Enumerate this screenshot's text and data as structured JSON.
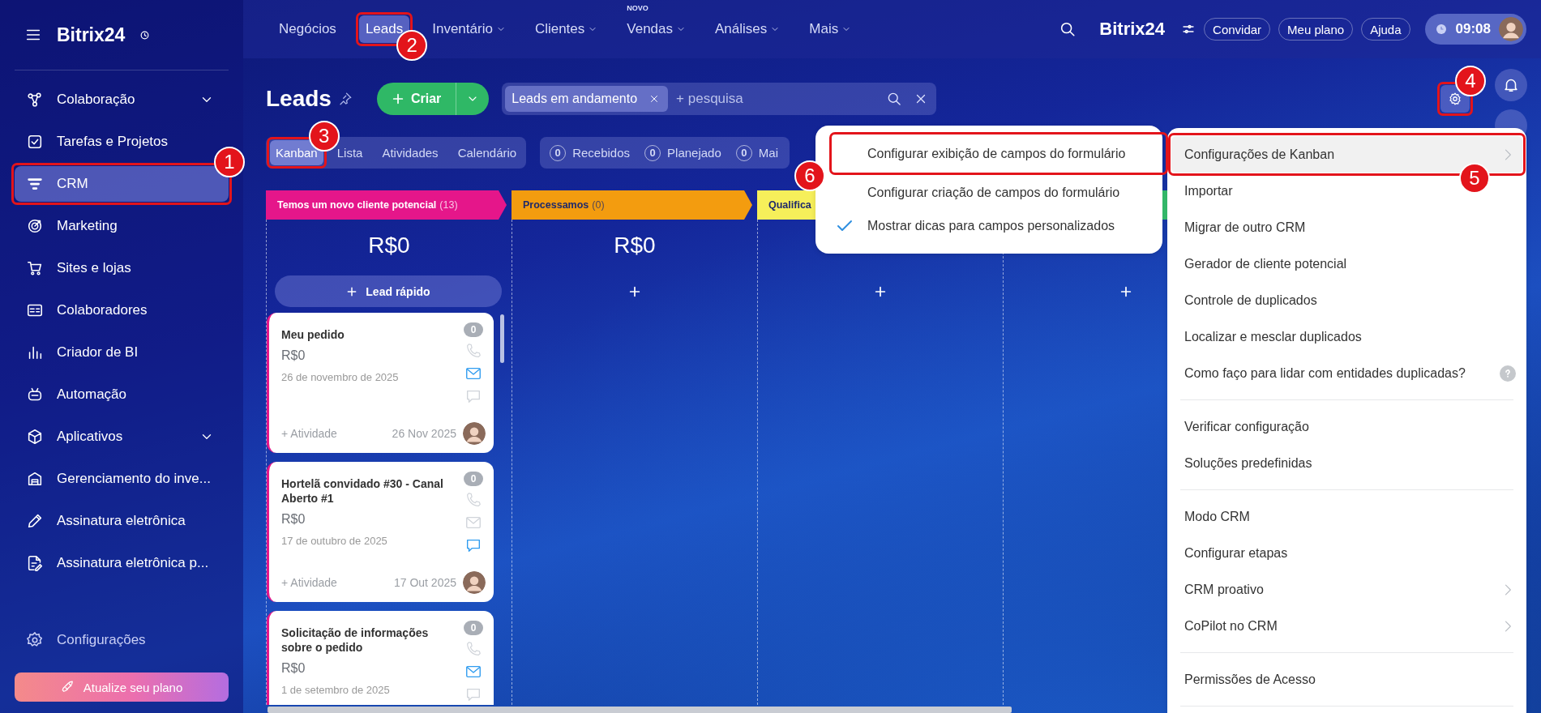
{
  "sidebar": {
    "logo": "Bitrix24",
    "items": [
      {
        "label": "Colaboração",
        "expandable": true,
        "selected": false
      },
      {
        "label": "Tarefas e Projetos",
        "expandable": false,
        "selected": false
      },
      {
        "label": "CRM",
        "expandable": false,
        "selected": true,
        "callout": "1"
      },
      {
        "label": "Marketing",
        "expandable": false,
        "selected": false
      },
      {
        "label": "Sites e lojas",
        "expandable": false,
        "selected": false
      },
      {
        "label": "Colaboradores",
        "expandable": false,
        "selected": false
      },
      {
        "label": "Criador de BI",
        "expandable": false,
        "selected": false
      },
      {
        "label": "Automação",
        "expandable": false,
        "selected": false
      },
      {
        "label": "Aplicativos",
        "expandable": true,
        "selected": false
      },
      {
        "label": "Gerenciamento do inve...",
        "expandable": false,
        "selected": false
      },
      {
        "label": "Assinatura eletrônica",
        "expandable": false,
        "selected": false
      },
      {
        "label": "Assinatura eletrônica p...",
        "expandable": false,
        "selected": false
      }
    ],
    "settings": "Configurações",
    "upgrade_button": "Atualize seu plano"
  },
  "topbar": {
    "nav": [
      {
        "label": "Negócios",
        "selected": false,
        "dropdown": false
      },
      {
        "label": "Leads",
        "selected": true,
        "dropdown": false,
        "callout": "2"
      },
      {
        "label": "Inventário",
        "selected": false,
        "dropdown": true
      },
      {
        "label": "Clientes",
        "selected": false,
        "dropdown": true
      },
      {
        "label": "Vendas",
        "selected": false,
        "dropdown": true,
        "badge": "NOVO"
      },
      {
        "label": "Análises",
        "selected": false,
        "dropdown": true
      },
      {
        "label": "Mais",
        "selected": false,
        "dropdown": true
      }
    ],
    "brand": "Bitrix24",
    "buttons": [
      "Convidar",
      "Meu plano",
      "Ajuda"
    ],
    "time": "09:08"
  },
  "toolbar": {
    "title": "Leads",
    "create_button": "Criar",
    "filter_chip": "Leads em andamento",
    "search_placeholder": "+ pesquisa",
    "settings_callout": "4"
  },
  "view_tabs": [
    {
      "label": "Kanban",
      "selected": true,
      "callout": "3"
    },
    {
      "label": "Lista",
      "selected": false
    },
    {
      "label": "Atividades",
      "selected": false
    },
    {
      "label": "Calendário",
      "selected": false
    }
  ],
  "counters": [
    {
      "count": "0",
      "label": "Recebidos"
    },
    {
      "count": "0",
      "label": "Planejado"
    },
    {
      "count": "0",
      "label": "Mai"
    }
  ],
  "columns": [
    {
      "title": "Temos um novo cliente potencial",
      "count": "(13)",
      "color": "#e5168a",
      "total": "R$0",
      "quick_add": "Lead rápido",
      "cards": [
        {
          "title": "Meu pedido",
          "amount": "R$0",
          "date": "26 de novembro de 2025",
          "activity": "+ Atividade",
          "short_date": "26 Nov 2025",
          "comments": "0",
          "call_active": false,
          "email_active": true,
          "chat_active": false
        },
        {
          "title": "Hortelã convidado #30 - Canal Aberto #1",
          "amount": "R$0",
          "date": "17 de outubro de 2025",
          "activity": "+ Atividade",
          "short_date": "17 Out 2025",
          "comments": "0",
          "call_active": false,
          "email_active": false,
          "chat_active": true
        },
        {
          "title": "Solicitação de informações sobre o pedido",
          "amount": "R$0",
          "date": "1 de setembro de 2025",
          "comments": "0",
          "call_active": false,
          "email_active": true,
          "chat_active": false
        }
      ]
    },
    {
      "title": "Processamos",
      "count": "(0)",
      "color": "#f39c0f",
      "total": "R$0"
    },
    {
      "title": "Qualifica",
      "color": "#f6ef5a"
    },
    {
      "color": "#36c06e"
    }
  ],
  "menu": {
    "groups": [
      [
        {
          "label": "Configurações de Kanban",
          "submenu": true,
          "selected": true,
          "callout": "5"
        },
        {
          "label": "Importar",
          "submenu": false,
          "selected": false
        },
        {
          "label": "Migrar de outro CRM",
          "submenu": false,
          "selected": false
        },
        {
          "label": "Gerador de cliente potencial",
          "submenu": false,
          "selected": false
        },
        {
          "label": "Controle de duplicados",
          "submenu": false,
          "selected": false
        },
        {
          "label": "Localizar e mesclar duplicados",
          "submenu": false,
          "selected": false
        },
        {
          "label": "Como faço para lidar com entidades duplicadas?",
          "submenu": false,
          "selected": false,
          "help": true
        }
      ],
      [
        {
          "label": "Verificar configuração",
          "submenu": false,
          "selected": false
        },
        {
          "label": "Soluções predefinidas",
          "submenu": false,
          "selected": false
        }
      ],
      [
        {
          "label": "Modo CRM",
          "submenu": false,
          "selected": false
        },
        {
          "label": "Configurar etapas",
          "submenu": false,
          "selected": false
        },
        {
          "label": "CRM proativo",
          "submenu": true,
          "selected": false
        },
        {
          "label": "CoPilot no CRM",
          "submenu": true,
          "selected": false
        }
      ],
      [
        {
          "label": "Permissões de Acesso",
          "submenu": false,
          "selected": false
        }
      ]
    ]
  },
  "submenu": {
    "items": [
      {
        "label": "Configurar exibição de campos do formulário",
        "checked": false,
        "callout": "6"
      },
      {
        "label": "Configurar criação de campos do formulário",
        "checked": false
      },
      {
        "label": "Mostrar dicas para campos personalizados",
        "checked": true
      }
    ]
  }
}
